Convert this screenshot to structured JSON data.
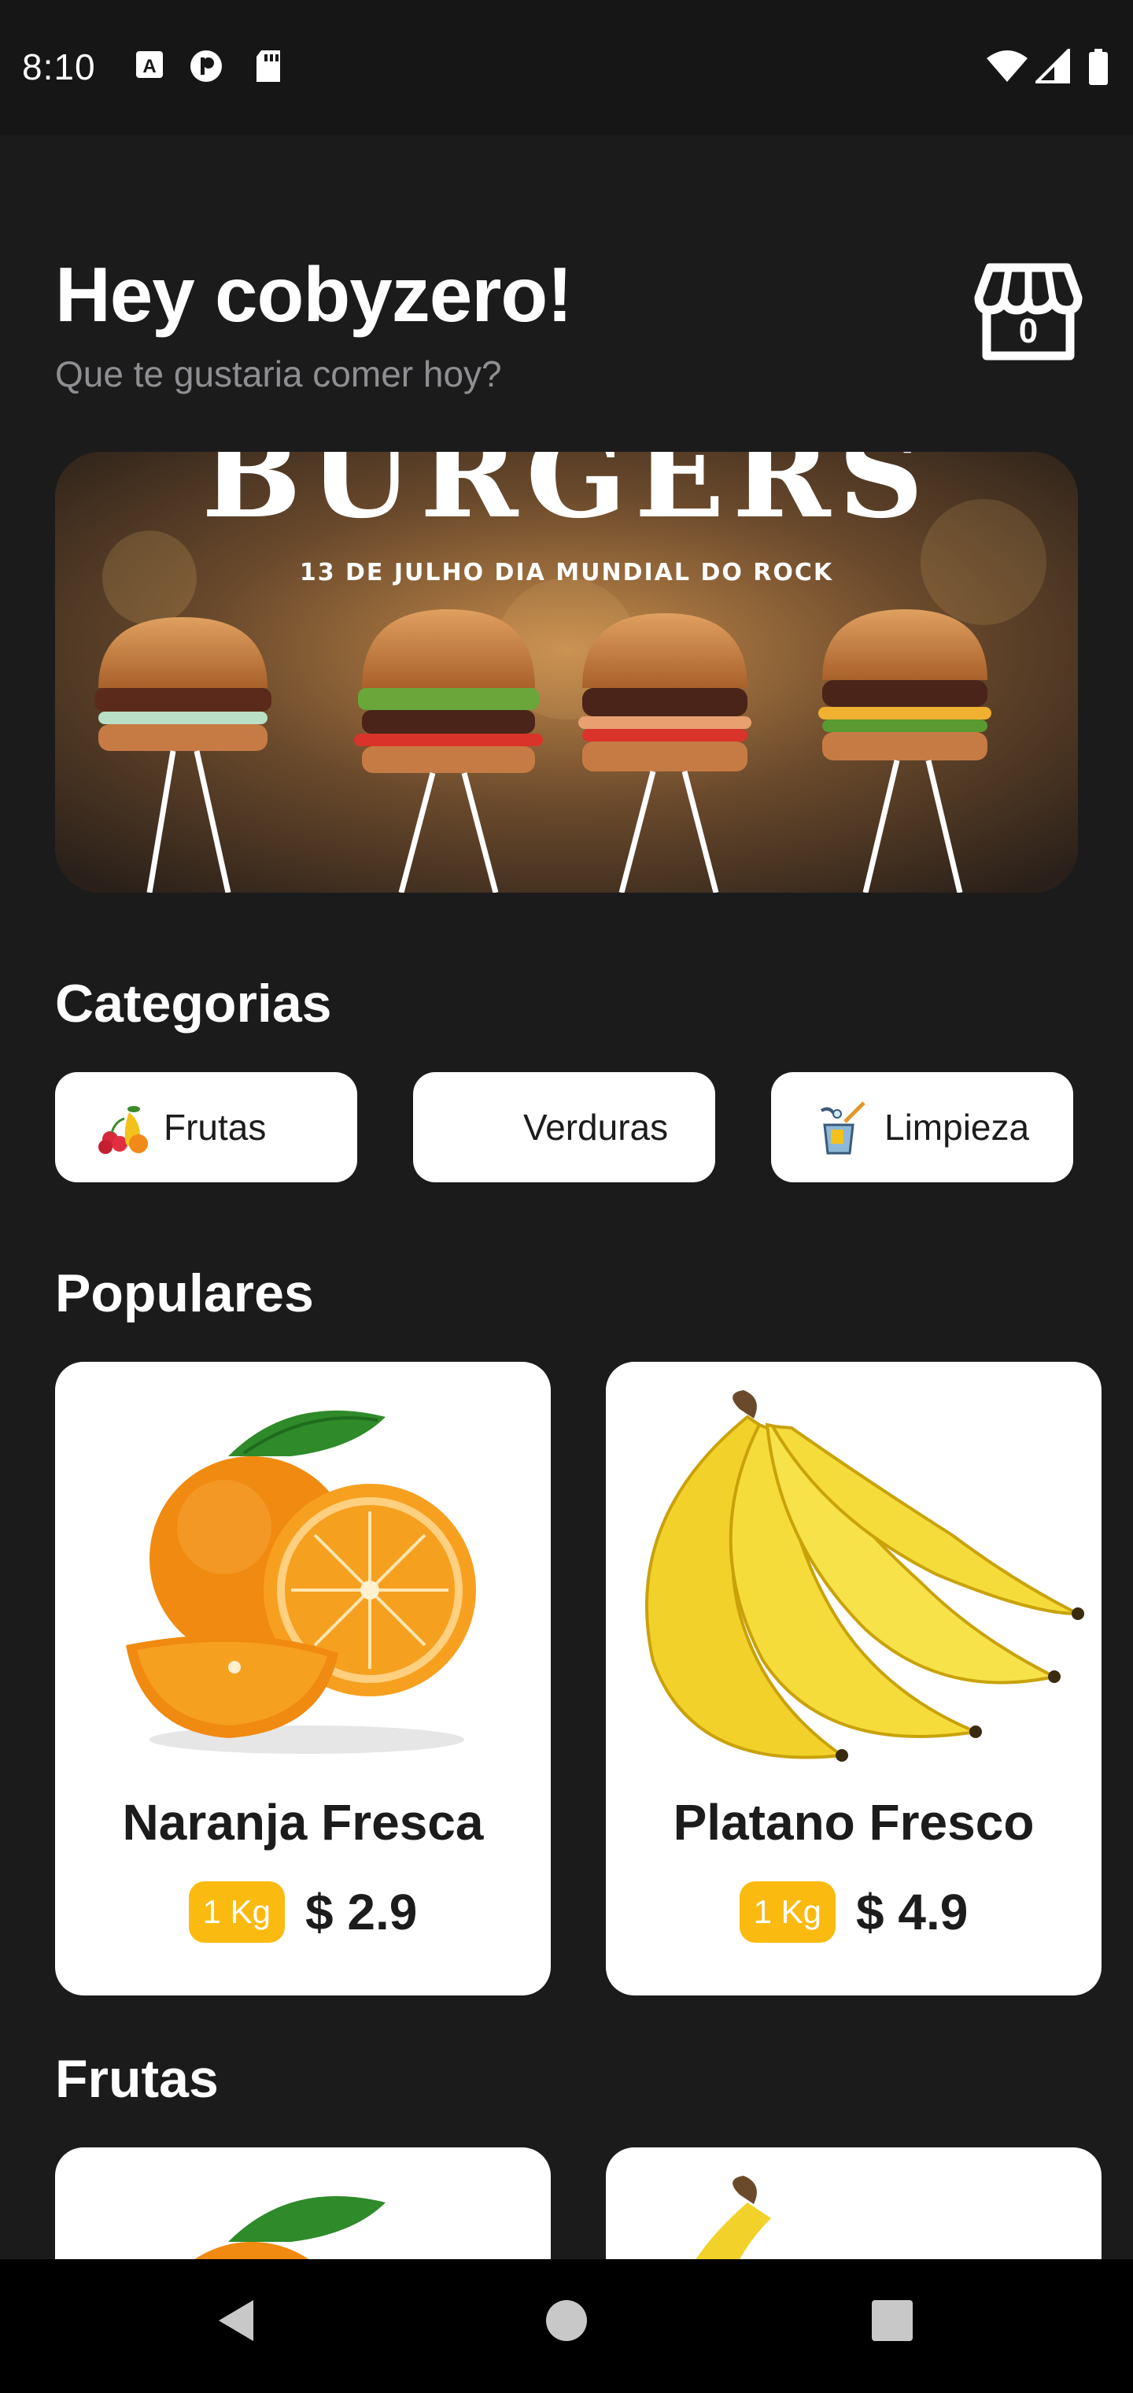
{
  "status_bar": {
    "time": "8:10",
    "icons": [
      "a-box-icon",
      "circle-p-icon",
      "sd-card-icon",
      "wifi-icon",
      "signal-icon",
      "battery-icon"
    ]
  },
  "header": {
    "greeting": "Hey cobyzero!",
    "subtitle": "Que te gustaria comer hoy?",
    "cart_count": "0"
  },
  "banner": {
    "headline": "BURGERS",
    "caption": "13 DE JULHO DIA MUNDIAL DO ROCK"
  },
  "categories": {
    "title": "Categorias",
    "items": [
      {
        "label": "Frutas",
        "icon": "fruits-icon"
      },
      {
        "label": "Verduras",
        "icon": ""
      },
      {
        "label": "Limpieza",
        "icon": "cleaning-icon"
      }
    ]
  },
  "populares": {
    "title": "Populares",
    "items": [
      {
        "name": "Naranja Fresca",
        "unit": "1 Kg",
        "price": "$ 2.9",
        "image": "orange"
      },
      {
        "name": "Platano Fresco",
        "unit": "1 Kg",
        "price": "$ 4.9",
        "image": "banana"
      }
    ]
  },
  "frutas": {
    "title": "Frutas"
  },
  "colors": {
    "background": "#1b1b1c",
    "accent": "#fbba10",
    "card": "#ffffff"
  }
}
